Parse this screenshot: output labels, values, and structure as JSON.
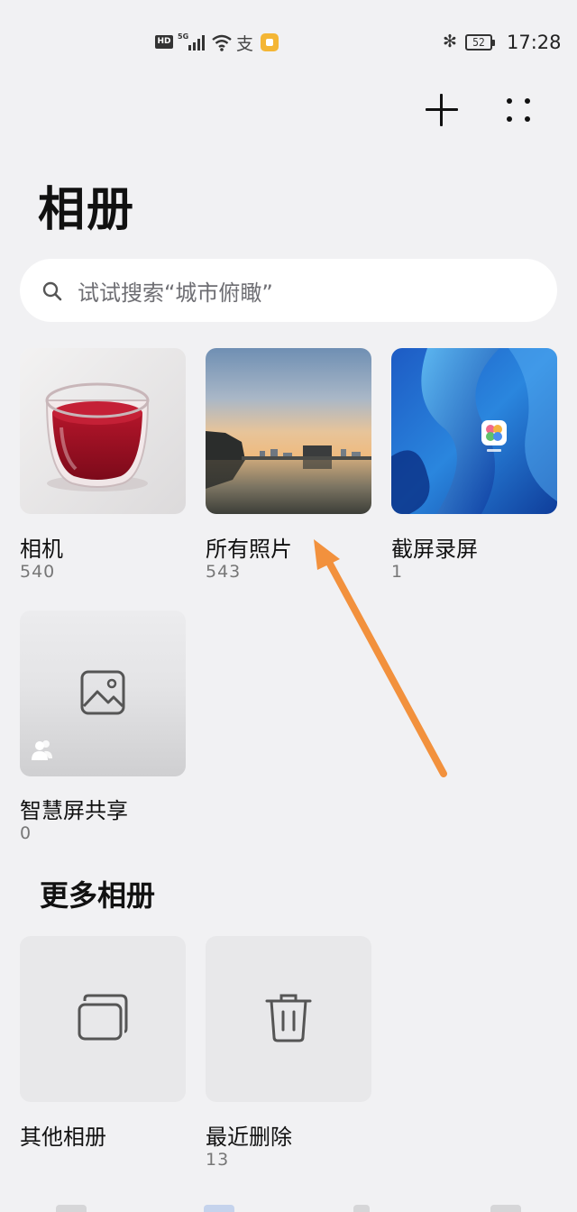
{
  "status_bar": {
    "hd": "HD",
    "network": "5G",
    "alipay_glyph": "支",
    "bluetooth_glyph": "✻",
    "battery": "52",
    "time": "17:28"
  },
  "header": {
    "add_icon": "plus-icon",
    "more_icon": "more-dots-icon"
  },
  "page_title": "相册",
  "search": {
    "placeholder": "试试搜索“城市俯瞰”",
    "icon": "search-icon"
  },
  "albums": [
    {
      "name": "相机",
      "count": "540"
    },
    {
      "name": "所有照片",
      "count": "543"
    },
    {
      "name": "截屏录屏",
      "count": "1"
    },
    {
      "name": "智慧屏共享",
      "count": "0"
    }
  ],
  "more_section": {
    "title": "更多相册",
    "items": [
      {
        "name": "其他相册",
        "count": ""
      },
      {
        "name": "最近删除",
        "count": "13"
      }
    ]
  },
  "colors": {
    "background": "#f1f1f3",
    "annotation_arrow": "#f2913d",
    "tile_placeholder": "#e8e8ea"
  }
}
